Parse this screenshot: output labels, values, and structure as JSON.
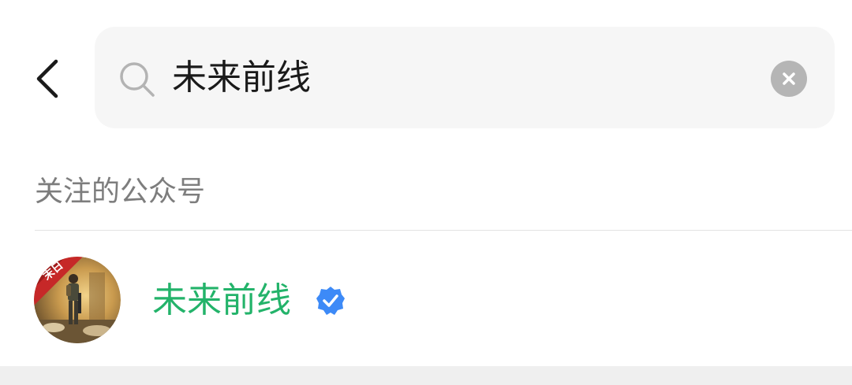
{
  "search": {
    "query": "未来前线"
  },
  "section": {
    "title": "关注的公众号"
  },
  "results": [
    {
      "name": "未来前线",
      "verified": true,
      "avatar_badge": "末日"
    }
  ],
  "colors": {
    "name_green": "#23b36a",
    "verified_blue": "#3d8af7",
    "clear_grey": "#b5b5b5",
    "search_bg": "#f6f6f6"
  },
  "icons": {
    "back": "chevron-left-icon",
    "search": "search-icon",
    "clear": "close-icon",
    "verified": "verified-icon"
  }
}
